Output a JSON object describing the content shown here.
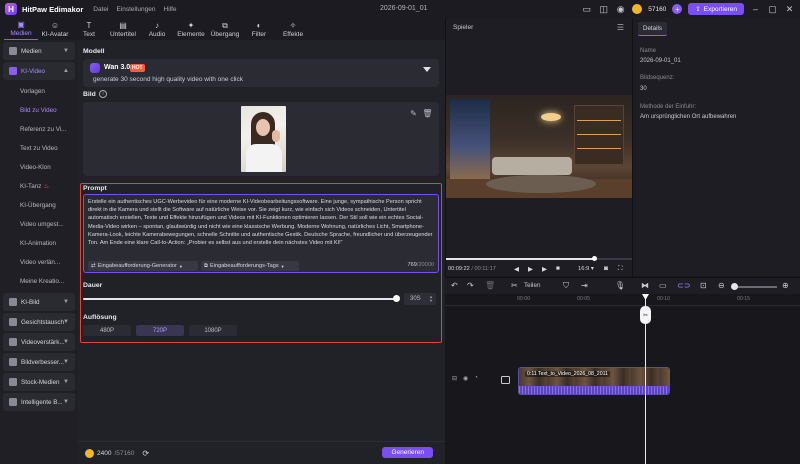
{
  "app": {
    "name": "HitPaw Edimakor",
    "menu": [
      "Datei",
      "Einstellungen",
      "Hilfe"
    ],
    "project_title": "2026-09-01_01",
    "credits": "57160",
    "export_label": "Exportieren"
  },
  "toolbar": {
    "items": [
      {
        "label": "Medien",
        "icon": "media-icon"
      },
      {
        "label": "KI-Avatar",
        "icon": "avatar-icon"
      },
      {
        "label": "Text",
        "icon": "text-icon"
      },
      {
        "label": "Untertitel",
        "icon": "subtitle-icon"
      },
      {
        "label": "Audio",
        "icon": "audio-icon"
      },
      {
        "label": "Elemente",
        "icon": "elements-icon"
      },
      {
        "label": "Übergang",
        "icon": "transition-icon"
      },
      {
        "label": "Filter",
        "icon": "filter-icon"
      },
      {
        "label": "Effekte",
        "icon": "effects-icon"
      }
    ]
  },
  "sidebar": {
    "sections": [
      {
        "label": "Medien"
      },
      {
        "label": "KI-Video"
      }
    ],
    "sub_items": [
      {
        "label": "Vorlagen"
      },
      {
        "label": "Bild zu Video"
      },
      {
        "label": "Referenz zu Vi..."
      },
      {
        "label": "Text zu Video"
      },
      {
        "label": "Video-Klon"
      },
      {
        "label": "KI-Tanz"
      },
      {
        "label": "KI-Übergang"
      },
      {
        "label": "Video umgest..."
      },
      {
        "label": "KI-Animation"
      },
      {
        "label": "Video verlän..."
      },
      {
        "label": "Meine Kreatio..."
      }
    ],
    "bottom_sections": [
      {
        "label": "KI-Bild"
      },
      {
        "label": "Gesichtstausch"
      },
      {
        "label": "Videoverstärk..."
      },
      {
        "label": "Bildverbesser..."
      },
      {
        "label": "Stock-Medien"
      },
      {
        "label": "Intelligente B..."
      }
    ]
  },
  "panel": {
    "model_label": "Modell",
    "model_name": "Wan 3.0",
    "model_badge": "HOT",
    "model_desc": "generate 30 second high quality video with one click",
    "image_label": "Bild",
    "prompt_label": "Prompt",
    "prompt_text": "Erstelle ein authentisches UGC-Werbevideo für eine moderne KI-Videobearbeitungssoftware. Eine junge, sympathische Person spricht direkt in die Kamera und stellt die Software auf natürliche Weise vor. Sie zeigt kurz, wie einfach sich Videos schneiden, Untertitel automatisch erstellen, Texte und Effekte hinzufügen und Videos mit KI-Funktionen optimieren lassen. Der Stil soll wie ein echtes Social-Media-Video wirken – spontan, glaubwürdig und nicht wie eine klassische Werbung. Moderne Wohnung, natürliches Licht, Smartphone-Kamera-Look, leichte Kamerabewegungen, schnelle Schnitte und authentische Gestik. Deutsche Sprache, freundlicher und überzeugender Ton. Am Ende eine klare Call-to-Action: „Probier es selbst aus und erstelle dein nächstes Video mit KI!“",
    "prompt_chip_1": "Eingabeaufforderung-Generator",
    "prompt_chip_2": "Eingabeaufforderungs-Tags",
    "prompt_count": "769",
    "prompt_max": "/20000",
    "duration_label": "Dauer",
    "duration_value": "30S",
    "duration_fraction": 1.0,
    "resolution_label": "Auflösung",
    "resolutions": [
      "480P",
      "720P",
      "1080P"
    ],
    "resolution_selected": "720P",
    "credits_used": "2400",
    "credits_total": "/57160",
    "generate_label": "Generieren"
  },
  "player": {
    "title": "Spieler",
    "time_current": "00:09:22",
    "time_total": "/ 00:11:17",
    "progress_fraction": 0.79,
    "aspect_ratio": "16:9"
  },
  "details": {
    "tab": "Details",
    "name_key": "Name",
    "name_val": "2026-09-01_01",
    "seq_key": "Bildsequenz:",
    "seq_val": "30",
    "method_key": "Methode der Einfuhr:",
    "method_val": "Am ursprünglichen Ort aufbewahren"
  },
  "timeline": {
    "split_label": "Teilen",
    "ticks": [
      "00:00",
      "00:05",
      "00:10",
      "00:15"
    ],
    "clip_label": "0:11 Text_to_Video_2026_08_2011"
  },
  "colors": {
    "accent": "#7a4df5",
    "frame_red": "#e0443a",
    "bg": "#16161b"
  }
}
